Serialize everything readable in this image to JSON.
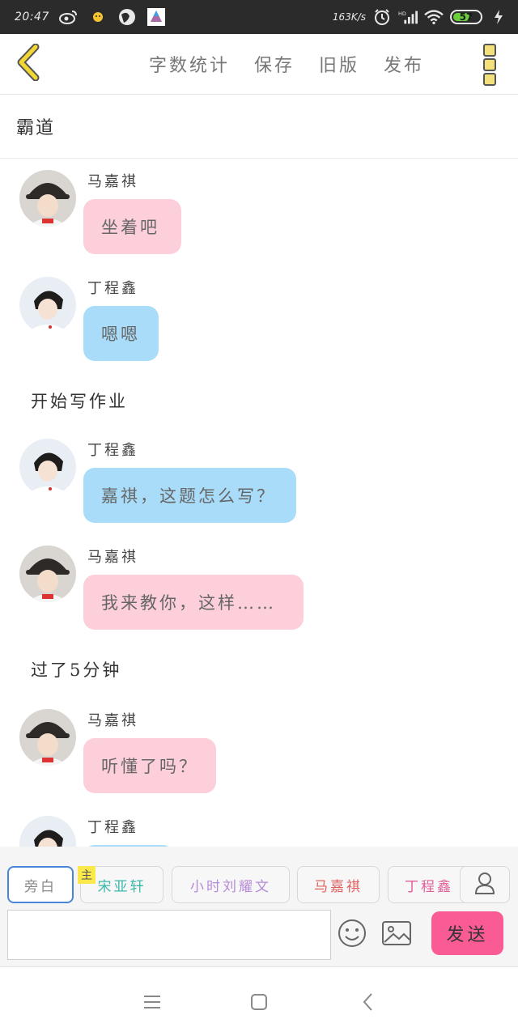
{
  "status_bar": {
    "time": "20:47",
    "net_speed": "163K/s",
    "battery": "57",
    "icons": [
      "weibo-icon",
      "notification-icon",
      "browser-icon",
      "app-icon",
      "alarm-icon",
      "signal-icon",
      "wifi-icon",
      "battery-icon",
      "charging-icon"
    ]
  },
  "toolbar": {
    "back_icon": "chevron-left-icon",
    "actions": [
      "字数统计",
      "保存",
      "旧版",
      "发布"
    ],
    "more_icon": "more-icon"
  },
  "title": "霸道",
  "messages": [
    {
      "type": "chat",
      "sender": "马嘉祺",
      "text": "坐着吧",
      "color": "#fdcfdb"
    },
    {
      "type": "chat",
      "sender": "丁程鑫",
      "text": "嗯嗯",
      "color": "#a8dcf8"
    },
    {
      "type": "narration",
      "text": "开始写作业"
    },
    {
      "type": "chat",
      "sender": "丁程鑫",
      "text": "嘉祺，这题怎么写？",
      "color": "#a8dcf8"
    },
    {
      "type": "chat",
      "sender": "马嘉祺",
      "text": "我来教你，这样……",
      "color": "#fdcfdb"
    },
    {
      "type": "narration",
      "text": "过了5分钟"
    },
    {
      "type": "chat",
      "sender": "马嘉祺",
      "text": "听懂了吗？",
      "color": "#fdcfdb"
    },
    {
      "type": "chat",
      "sender": "丁程鑫",
      "text": "",
      "color": "#a8dcf8"
    }
  ],
  "characters": [
    {
      "name": "旁白",
      "color": "#888888",
      "selected": true
    },
    {
      "name": "宋亚轩",
      "color": "#3cb7a8",
      "lead_badge": "主"
    },
    {
      "name": "小时刘耀文",
      "color": "#b58ad8"
    },
    {
      "name": "马嘉祺",
      "color": "#e06060"
    },
    {
      "name": "丁程鑫",
      "color": "#e0609a"
    }
  ],
  "input": {
    "value": "",
    "placeholder": "",
    "send_label": "发送"
  },
  "colors": {
    "accent_send": "#fb5b94",
    "pink_bubble": "#fdcfdb",
    "blue_bubble": "#a8dcf8",
    "back_arrow": "#f2d633"
  }
}
